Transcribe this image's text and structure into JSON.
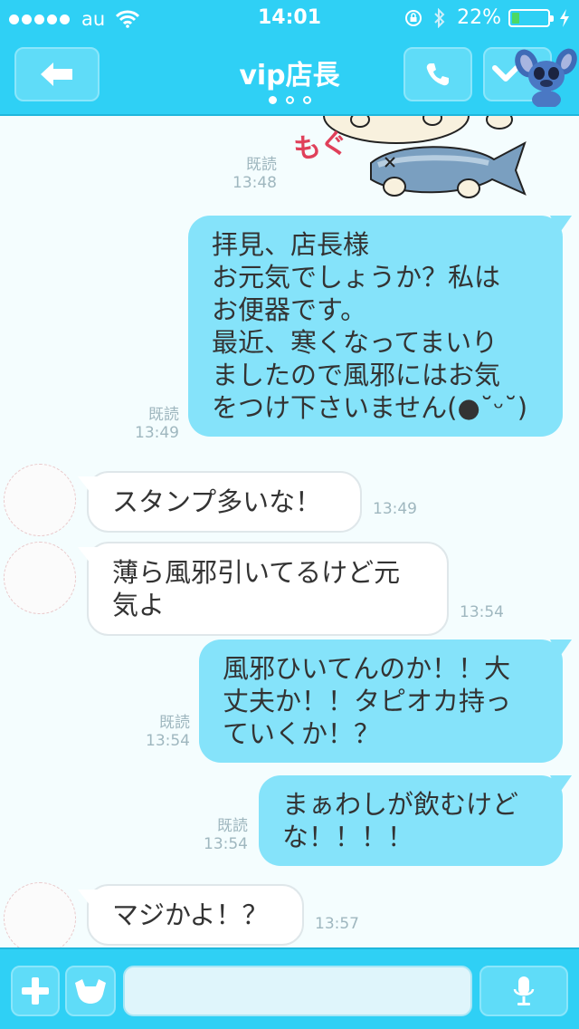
{
  "status_bar": {
    "carrier": "au",
    "time": "14:01",
    "battery_percent": "22%",
    "battery_level": 0.22
  },
  "nav": {
    "title": "vip店長",
    "page_count": 3,
    "current_page": 1
  },
  "chat": {
    "sticker_text": "もぐ",
    "messages": [
      {
        "side": "sent",
        "type": "sticker",
        "read": "既読",
        "time": "13:48"
      },
      {
        "side": "sent",
        "text_lines": [
          "拝見、店長様",
          "お元気でしょうか？私は",
          "お便器です。",
          "最近、寒くなってまいり",
          "ましたので風邪にはお気",
          "をつけ下さいません(●˘ᵕ˘)"
        ],
        "read": "既読",
        "time": "13:49"
      },
      {
        "side": "recv",
        "text_lines": [
          "スタンプ多いな！"
        ],
        "time": "13:49"
      },
      {
        "side": "recv",
        "text_lines": [
          "薄ら風邪引いてるけど元",
          "気よ"
        ],
        "time": "13:54"
      },
      {
        "side": "sent",
        "text_lines": [
          "風邪ひいてんのか！！大",
          "丈夫か！！タピオカ持っ",
          "ていくか！？"
        ],
        "read": "既読",
        "time": "13:54"
      },
      {
        "side": "sent",
        "text_lines": [
          "まぁわしが飲むけど",
          "な！！！！"
        ],
        "read": "既読",
        "time": "13:54"
      },
      {
        "side": "recv",
        "text_lines": [
          "マジかよ！？"
        ],
        "time": "13:57"
      }
    ]
  },
  "input": {
    "value": "",
    "placeholder": ""
  },
  "colors": {
    "header": "#2fd0f5",
    "sent_bubble": "#85e3fa",
    "recv_bubble": "#ffffff",
    "background": "#f4fdfe",
    "meta_text": "#9fb7bf",
    "battery_fill": "#4cd964"
  },
  "icons": [
    "wifi-icon",
    "lock-rotation-icon",
    "bluetooth-icon",
    "battery-icon",
    "charging-bolt-icon",
    "back-arrow-icon",
    "phone-icon",
    "chevron-down-icon",
    "stitch-avatar-icon",
    "plus-icon",
    "emoji-face-icon",
    "microphone-icon"
  ]
}
